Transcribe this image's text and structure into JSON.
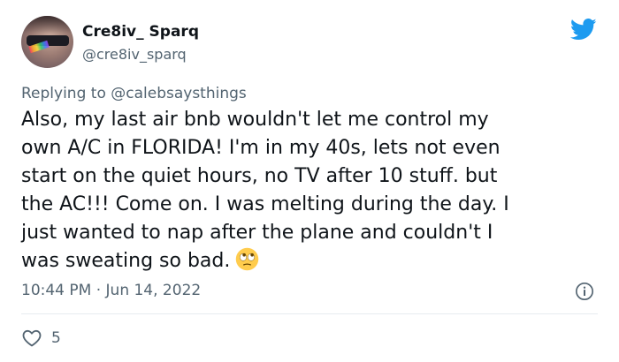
{
  "author": {
    "display_name": "Cre8iv_ Sparq",
    "handle": "@cre8iv_sparq"
  },
  "reply": {
    "prefix": "Replying to ",
    "to": "@calebsaysthings"
  },
  "tweet": {
    "text": "Also, my last air bnb wouldn't let me control my\nown A/C in FLORIDA! I'm in my 40s, lets not even\nstart on the quiet hours, no TV after 10 stuff. but\nthe AC!!! Come on. I was melting during the day. I\njust wanted to nap after the plane and couldn't I\nwas sweating so bad.",
    "emoji": "face-with-rolling-eyes"
  },
  "meta": {
    "timestamp": "10:44 PM · Jun 14, 2022"
  },
  "actions": {
    "like_count": "5"
  },
  "icons": {
    "brand": "twitter-bird-icon",
    "info": "info-icon",
    "like": "heart-icon"
  },
  "colors": {
    "brand": "#1d9bf0",
    "text": "#0f1419",
    "secondary": "#536471",
    "divider": "#e6ecf0"
  }
}
